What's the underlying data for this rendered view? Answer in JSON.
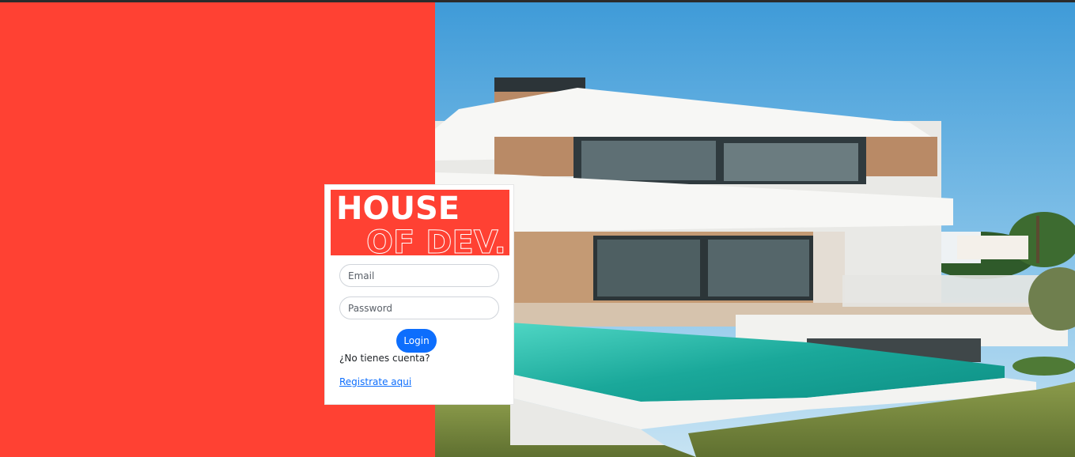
{
  "brand": {
    "line1": "HOUSE",
    "line2": "OF DEV."
  },
  "colors": {
    "brand_red": "#ff4133",
    "primary_blue": "#0d6efd"
  },
  "login": {
    "email_placeholder": "Email",
    "password_placeholder": "Password",
    "login_label": "Login",
    "no_account_text": "¿No tienes cuenta?",
    "register_link_text": "Registrate aqui"
  }
}
